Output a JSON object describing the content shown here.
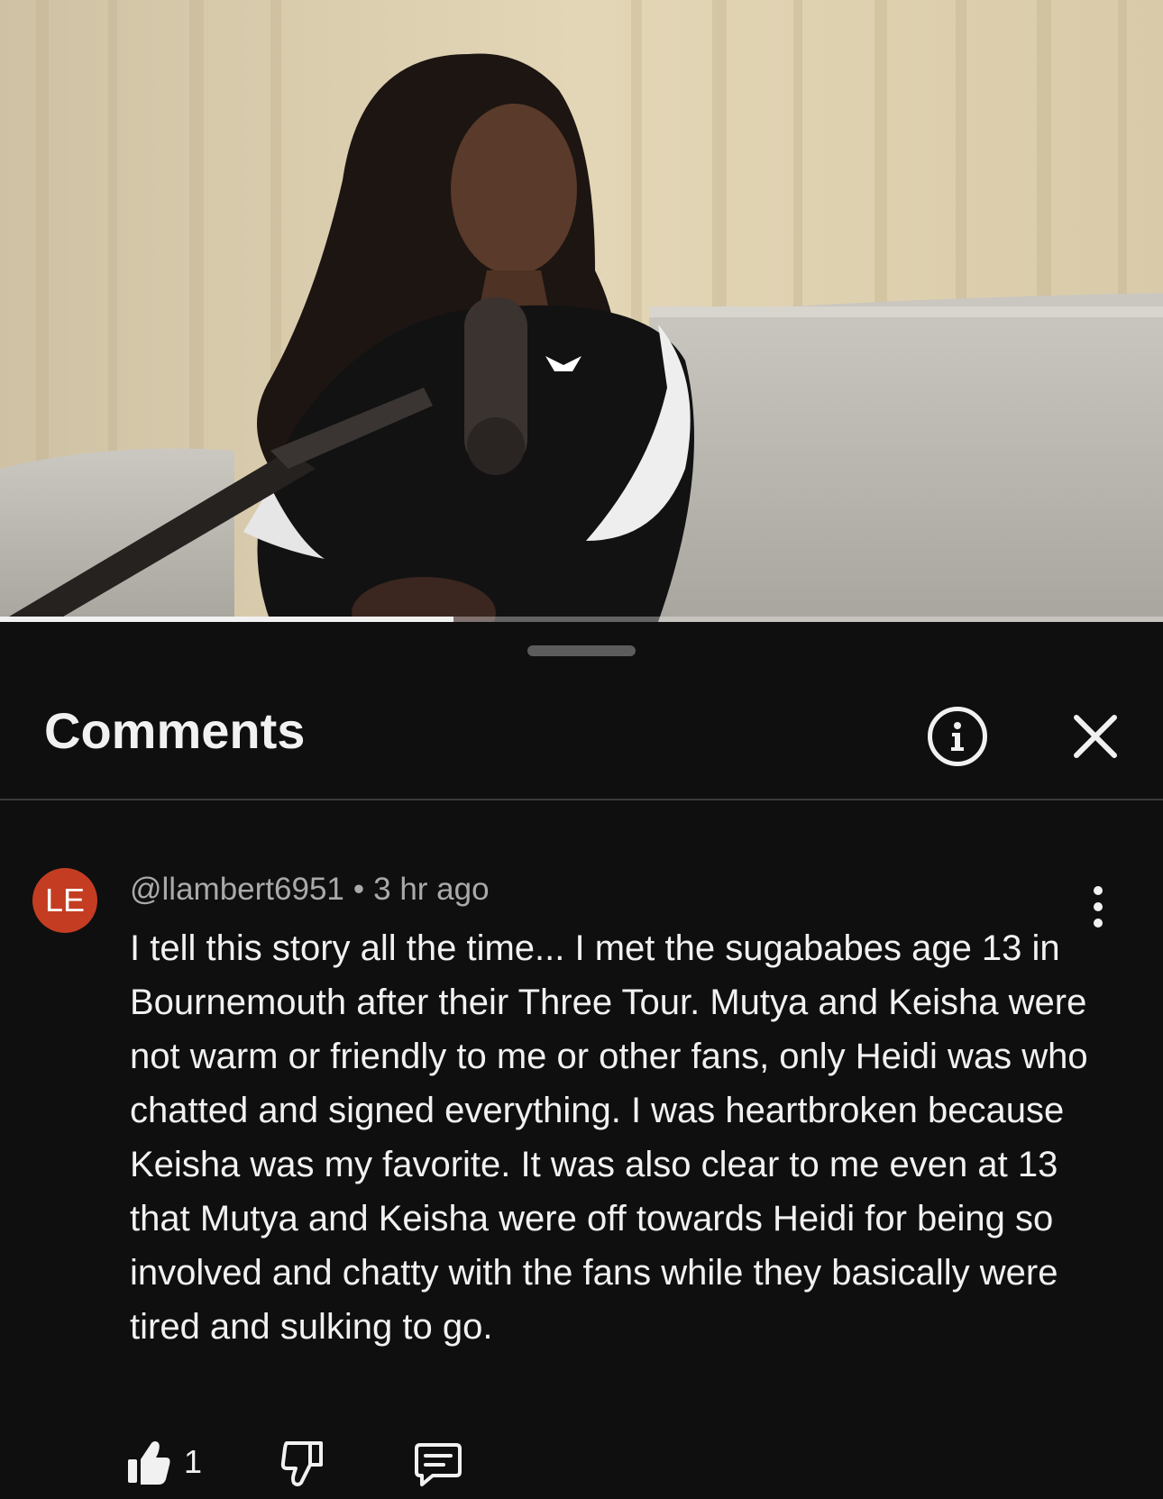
{
  "video": {
    "progress": 0.39
  },
  "comments_panel": {
    "title": "Comments",
    "info_icon": "info-icon",
    "close_icon": "close-icon"
  },
  "comment": {
    "avatar_initials": "LE",
    "avatar_color": "#c43d22",
    "author": "@llambert6951",
    "separator": "•",
    "time": "3 hr ago",
    "text": "I tell this story all the time... I met the sugababes age 13 in Bournemouth after their Three Tour. Mutya and Keisha were not warm or friendly to me or other fans, only Heidi was who chatted and signed everything. I was heartbroken because Keisha was my favorite. It was also clear to me even at 13 that Mutya and Keisha were off towards Heidi for being so involved and chatty with the fans while they basically were tired and sulking to go.",
    "like_count": "1",
    "icons": [
      "more-vert-icon",
      "thumb-up-icon",
      "thumb-down-icon",
      "reply-icon"
    ]
  }
}
